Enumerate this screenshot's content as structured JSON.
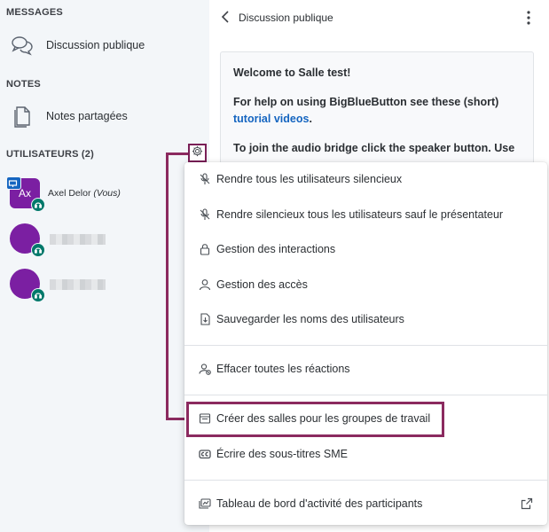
{
  "sidebar": {
    "messages_title": "MESSAGES",
    "public_chat_label": "Discussion publique",
    "notes_title": "NOTES",
    "shared_notes_label": "Notes partagées",
    "users_title": "UTILISATEURS (2)",
    "users": [
      {
        "initials": "Ax",
        "name": "Axel Delor",
        "suffix": "(Vous)"
      }
    ]
  },
  "chat": {
    "title": "Discussion publique",
    "welcome_prefix": "Welcome to ",
    "welcome_room": "Salle test",
    "welcome_suffix": "!",
    "help_text": "For help on using BigBlueButton see these (short)",
    "help_link": "tutorial videos",
    "help_end": ".",
    "audio_text": "To join the audio bridge click the speaker button. Use"
  },
  "menu": {
    "items": [
      {
        "label": "Rendre tous les utilisateurs silencieux",
        "icon": "mic-off-icon"
      },
      {
        "label": "Rendre silencieux tous les utilisateurs sauf le présentateur",
        "icon": "mic-off-icon"
      },
      {
        "label": "Gestion des interactions",
        "icon": "lock-icon"
      },
      {
        "label": "Gestion des accès",
        "icon": "user-icon"
      },
      {
        "label": "Sauvegarder les noms des utilisateurs",
        "icon": "download-file-icon"
      },
      {
        "label": "Effacer toutes les réactions",
        "icon": "clear-reactions-icon"
      },
      {
        "label": "Créer des salles pour les groupes de travail",
        "icon": "breakout-rooms-icon"
      },
      {
        "label": "Écrire des sous-titres SME",
        "icon": "closed-captions-icon"
      },
      {
        "label": "Tableau de bord d'activité des participants",
        "icon": "dashboard-icon"
      }
    ]
  },
  "colors": {
    "accent_frame": "#8b2a5f",
    "avatar": "#7b1fa2",
    "link": "#1565c0",
    "sidebar_bg": "#f3f6f9"
  }
}
